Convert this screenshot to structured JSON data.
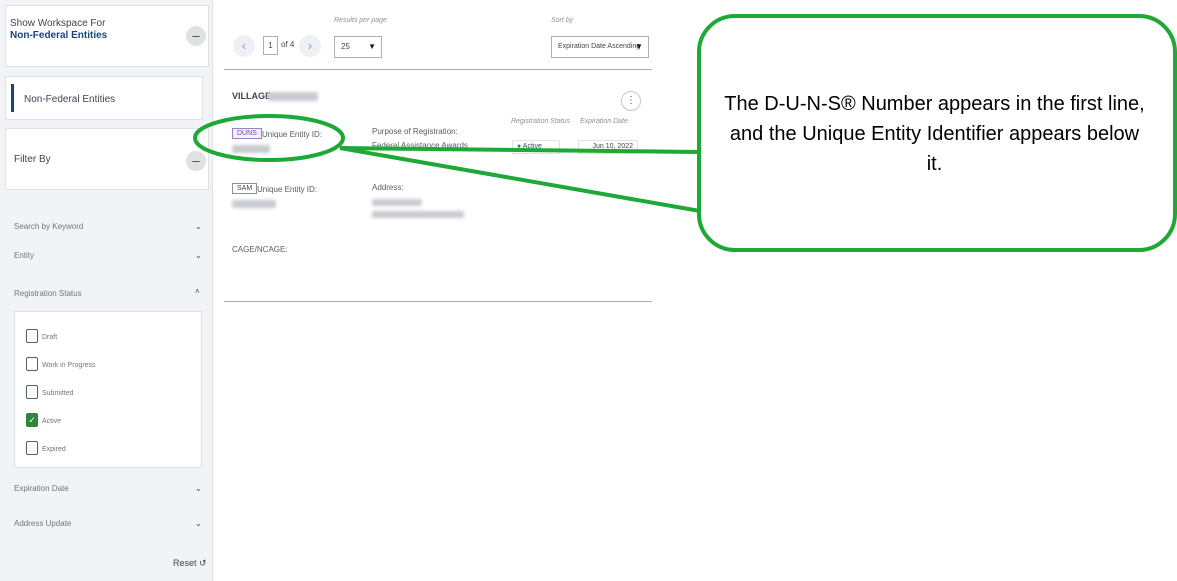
{
  "sidebar": {
    "workspace_label": "Show Workspace For",
    "workspace_value": "Non-Federal Entities",
    "workspace_toggle": "–",
    "selected_workspace": "Non-Federal Entities",
    "filter_title": "Filter By",
    "filter_toggle": "–",
    "facets": {
      "keyword": "Search by Keyword",
      "entity": "Entity",
      "registration_status": "Registration Status",
      "expiration_date": "Expiration Date",
      "address_update": "Address Update"
    },
    "status_options": [
      {
        "label": "Draft",
        "checked": false
      },
      {
        "label": "Work in Progress",
        "checked": false
      },
      {
        "label": "Submitted",
        "checked": false
      },
      {
        "label": "Active",
        "checked": true
      },
      {
        "label": "Expired",
        "checked": false
      }
    ],
    "reset_label": "Reset",
    "reset_icon": "↺"
  },
  "pagination": {
    "prev": "‹",
    "current_page": "1",
    "of_total": "of 4",
    "next": "›",
    "results_per_page_label": "Results per page",
    "results_per_page": "25",
    "sort_by_label": "Sort by",
    "sort_by": "Expiration Date Ascending",
    "dropdown_arrow": "▼"
  },
  "result": {
    "entity_name": "VILLAGE",
    "more_icon": "⋮",
    "duns_tag": "DUNS",
    "unique_entity_id_label": "Unique Entity ID:",
    "purpose_label": "Purpose of Registration:",
    "purpose_value": "Federal Assistance Awards",
    "registration_status_label": "Registration Status",
    "registration_status_value": "Active",
    "status_dot": "●",
    "expiration_date_label": "Expiration Date",
    "expiration_date_value": "Jun 10, 2022",
    "sam_tag": "SAM",
    "sam_unique_entity_id_label": "Unique Entity ID:",
    "address_label": "Address:",
    "cage_label": "CAGE/NCAGE:"
  },
  "callout": {
    "text": "The D-U-N-S® Number appears in the first line, and the Unique Entity Identifier appears below it.",
    "border_color": "#1ea835"
  }
}
